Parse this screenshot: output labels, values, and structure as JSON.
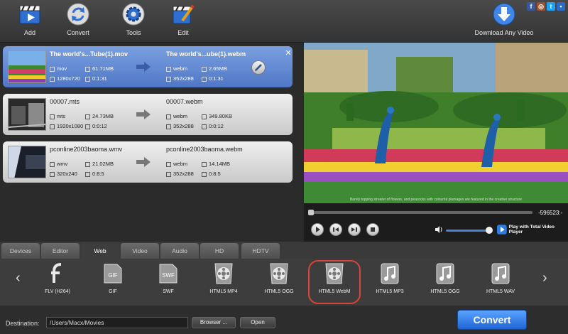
{
  "toolbar": {
    "add_label": "Add",
    "convert_label": "Convert",
    "tools_label": "Tools",
    "edit_label": "Edit",
    "download_label": "Download Any Video"
  },
  "social": {
    "facebook": "f",
    "instagram": "◎",
    "twitter": "t",
    "chat": "•"
  },
  "files": [
    {
      "name": "The world's...Tube(1).mov",
      "format": "mov",
      "size": "61.71MB",
      "resolution": "1280x720",
      "duration": "0:1:31",
      "out_name": "The world's...ube(1).webm",
      "out_format": "webm",
      "out_size": "2.65MB",
      "out_resolution": "352x288",
      "out_duration": "0:1:31"
    },
    {
      "name": "00007.mts",
      "format": "mts",
      "size": "24.73MB",
      "resolution": "1920x1080",
      "duration": "0:0:12",
      "out_name": "00007.webm",
      "out_format": "webm",
      "out_size": "349.80KB",
      "out_resolution": "352x288",
      "out_duration": "0:0:12"
    },
    {
      "name": "pconline2003baoma.wmv",
      "format": "wmv",
      "size": "21.02MB",
      "resolution": "320x240",
      "duration": "0:8:5",
      "out_name": "pconline2003baoma.webm",
      "out_format": "webm",
      "out_size": "14.14MB",
      "out_resolution": "352x288",
      "out_duration": "0:8:5"
    }
  ],
  "preview": {
    "caption": "Barely topping streater of flowers, and peacocks with colourful plumages are featured in the creative structure",
    "time": "-596523:-",
    "play_total_label": "Play with Total Video Player"
  },
  "tabs": [
    "Devices",
    "Editor",
    "Web",
    "Video",
    "Audio",
    "HD",
    "HDTV"
  ],
  "formats": [
    "FLV (H264)",
    "GIF",
    "SWF",
    "HTML5 MP4",
    "HTML5 OGG",
    "HTML5 WebM",
    "HTML5 MP3",
    "HTML5 OGG",
    "HTML5 WAV"
  ],
  "bottom": {
    "destination_label": "Destination:",
    "destination_value": "/Users/Macx/Movies",
    "browse_label": "Browser ...",
    "open_label": "Open",
    "convert_label": "Convert"
  }
}
